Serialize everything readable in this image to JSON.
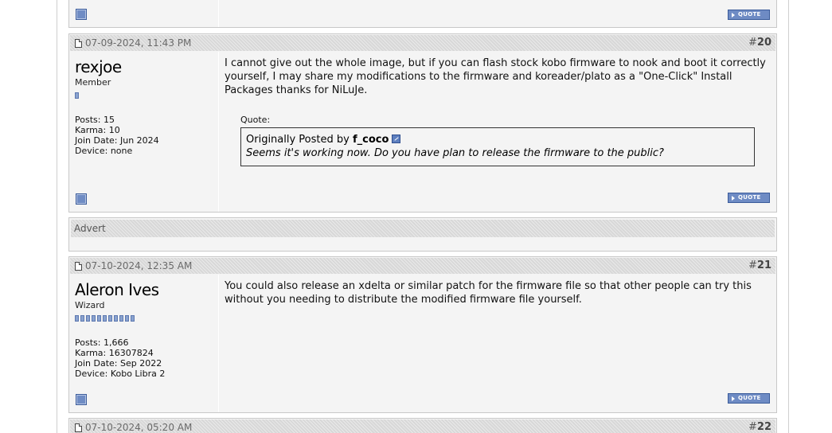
{
  "posts": [
    {
      "date": "07-09-2024, 11:43 PM",
      "number": "20",
      "username": "rexjoe",
      "usertitle": "Member",
      "rep_level": 1,
      "posts": "Posts: 15",
      "karma": "Karma: 10",
      "join_date": "Join Date: Jun 2024",
      "device": "Device: none",
      "message": "I cannot give out the whole image, but if you can flash stock kobo firmware to nook and boot it correctly yourself, I may share my modifications to the firmware and koreader/plato as a \"One-Click\" Install Packages thanks for NiLuJe.",
      "quote": {
        "label": "Quote:",
        "originally_posted_by": "Originally Posted by",
        "author": "f_coco",
        "text": "Seems it's working now. Do you have plan to release the firmware to the public?"
      },
      "quote_button": "QUOTE"
    },
    {
      "date": "07-10-2024, 12:35 AM",
      "number": "21",
      "username": "Aleron Ives",
      "usertitle": "Wizard",
      "rep_level": 11,
      "posts": "Posts: 1,666",
      "karma": "Karma: 16307824",
      "join_date": "Join Date: Sep 2022",
      "device": "Device: Kobo Libra 2",
      "message": "You could also release an xdelta or similar patch for the firmware file so that other people can try this without you needing to distribute the modified firmware file yourself.",
      "quote_button": "QUOTE"
    },
    {
      "date": "07-10-2024, 05:20 AM",
      "number": "22"
    }
  ],
  "advert": {
    "label": "Advert"
  },
  "prev_post": {
    "quote_button": "QUOTE"
  },
  "hash": "#"
}
